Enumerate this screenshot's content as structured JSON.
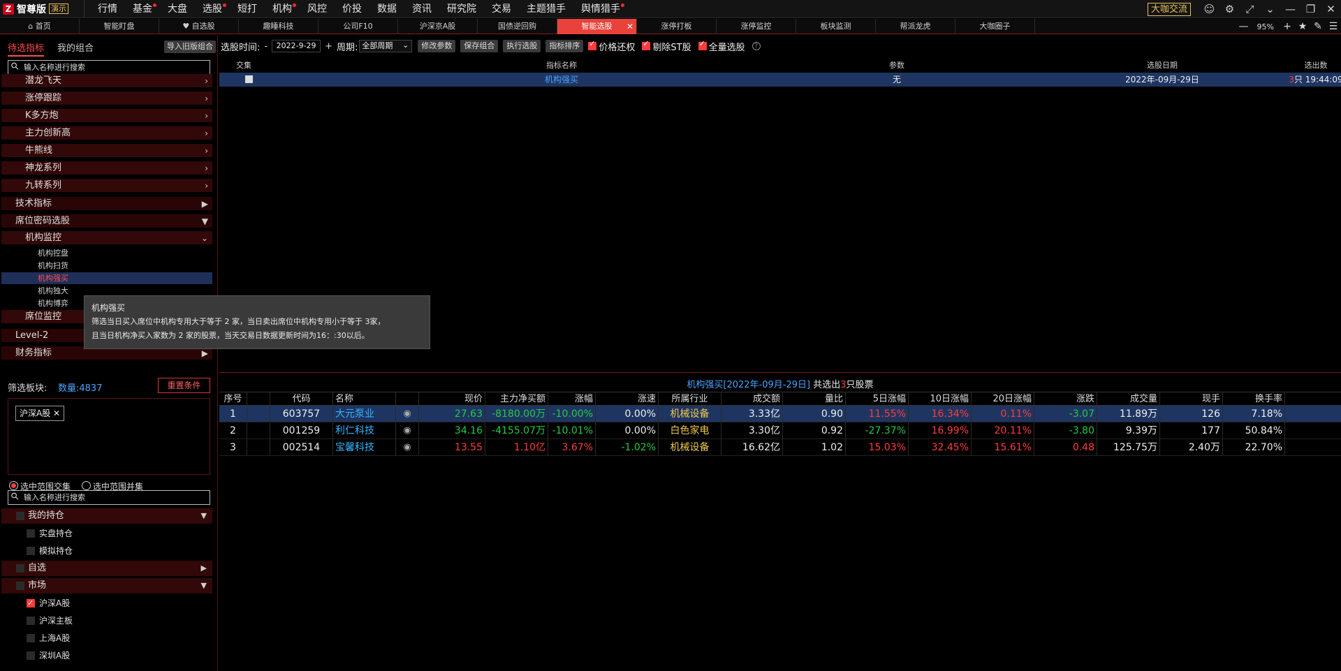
{
  "app": {
    "logo_mark": "Z",
    "brand": "智尊版",
    "demo": "演示",
    "menu": [
      {
        "label": "行情",
        "dot": false
      },
      {
        "label": "基金",
        "dot": true
      },
      {
        "label": "大盘",
        "dot": false
      },
      {
        "label": "选股",
        "dot": true
      },
      {
        "label": "短打",
        "dot": false
      },
      {
        "label": "机构",
        "dot": true
      },
      {
        "label": "风控",
        "dot": false
      },
      {
        "label": "价投",
        "dot": false
      },
      {
        "label": "数据",
        "dot": false
      },
      {
        "label": "资讯",
        "dot": false
      },
      {
        "label": "研究院",
        "dot": false
      },
      {
        "label": "交易",
        "dot": false
      },
      {
        "label": "主题猎手",
        "dot": false
      },
      {
        "label": "舆情猎手",
        "dot": true
      }
    ],
    "dkjl": "大咖交流"
  },
  "tabs": [
    "首页",
    "智能盯盘",
    "自选股",
    "趣睡科技",
    "公司F10",
    "沪深京A股",
    "国债逆回购",
    "智能选股",
    "涨停打板",
    "涨停监控",
    "板块监测",
    "帮派龙虎",
    "大咖圈子"
  ],
  "tab_icons": {
    "home": "home-icon",
    "fav": "heart-icon"
  },
  "zoom": "95%",
  "left": {
    "tab1": "待选指标",
    "tab2": "我的组合",
    "import_btn": "导入旧版组合",
    "search_placeholder": "输入名称进行搜索",
    "tree_sub": [
      "潜龙飞天",
      "涨停跟踪",
      "K多方炮",
      "主力创新高",
      "牛熊线",
      "神龙系列",
      "九转系列"
    ],
    "tree_top1": "技术指标",
    "tree_top2": "席位密码选股",
    "tree_sub2": "机构监控",
    "tree_leaves": [
      "机构控盘",
      "机构扫货",
      "机构强买",
      "机构独大",
      "机构博弈"
    ],
    "tree_sub3": "席位监控",
    "tree_top3": "Level-2",
    "tree_top4": "财务指标",
    "filter_label": "筛选板块:",
    "filter_count": "数量:4837",
    "reset_btn": "重置条件",
    "chip": "沪深A股",
    "radio1": "选中范围交集",
    "radio2": "选中范围并集",
    "search2_placeholder": "输入名称进行搜索",
    "groups": [
      {
        "label": "我的持仓",
        "kind": "grp",
        "arrow": "▼",
        "checked": false
      },
      {
        "label": "实盘持仓",
        "kind": "item",
        "checked": false
      },
      {
        "label": "模拟持仓",
        "kind": "item",
        "checked": false
      },
      {
        "label": "自选",
        "kind": "grp",
        "arrow": "▶",
        "checked": false
      },
      {
        "label": "市场",
        "kind": "grp",
        "arrow": "▼",
        "checked": false
      },
      {
        "label": "沪深A股",
        "kind": "item",
        "checked": true
      },
      {
        "label": "沪深主板",
        "kind": "item",
        "checked": false
      },
      {
        "label": "上海A股",
        "kind": "item",
        "checked": false
      },
      {
        "label": "深圳A股",
        "kind": "item",
        "checked": false
      }
    ]
  },
  "tooltip": {
    "title": "机构强买",
    "line1": "筛选当日买入席位中机构专用大于等于 2 家，当日卖出席位中机构专用小于等于 3家，",
    "line2": "且当日机构净买入家数为 2 家的股票，当天交易日数据更新时间为16：:30以后。"
  },
  "toolbar": {
    "date_label": "选股时间:",
    "minus": "-",
    "date": "2022-9-29",
    "plus": "+",
    "period_label": "周期:",
    "period": "全部周期",
    "btn_modify": "修改参数",
    "btn_save": "保存组合",
    "btn_run": "执行选股",
    "btn_sort": "指标排序",
    "chk1": "价格还权",
    "chk2": "剔除ST股",
    "chk3": "全量选股",
    "help": "?"
  },
  "upper": {
    "headers": [
      "交集",
      "指标名称",
      "参数",
      "选股日期",
      "选出数"
    ],
    "row": {
      "name": "机构强买",
      "param": "无",
      "date": "2022年-09月-29日",
      "count_num": "3",
      "count_rest": "只 19:44:09"
    }
  },
  "result": {
    "title_blue": "机构强买[2022年-09月-29日]",
    "title_mid": " 共选出",
    "title_count": "3",
    "title_end": "只股票"
  },
  "table": {
    "headers": [
      "序号",
      "",
      "代码",
      "名称",
      "",
      "现价",
      "主力净买额",
      "涨幅",
      "涨速",
      "所属行业",
      "成交额",
      "量比",
      "5日涨幅",
      "10日涨幅",
      "20日涨幅",
      "涨跌",
      "成交量",
      "现手",
      "换手率"
    ],
    "rows": [
      {
        "no": "1",
        "code": "603757",
        "name": "大元泵业",
        "price": "27.63",
        "net": "-8180.00万",
        "chg": "-10.00%",
        "speed": "0.00%",
        "ind": "机械设备",
        "amt": "3.33亿",
        "vr": "0.90",
        "d5": "11.55%",
        "d10": "16.34%",
        "d20": "0.11%",
        "diff": "-3.07",
        "vol": "11.89万",
        "hand": "126",
        "turn": "7.18%",
        "cls": {
          "price": "down",
          "net": "down",
          "chg": "down",
          "speed": "white",
          "d5": "up",
          "d10": "up",
          "d20": "up",
          "diff": "down"
        }
      },
      {
        "no": "2",
        "code": "001259",
        "name": "利仁科技",
        "price": "34.16",
        "net": "-4155.07万",
        "chg": "-10.01%",
        "speed": "0.00%",
        "ind": "白色家电",
        "amt": "3.30亿",
        "vr": "0.92",
        "d5": "-27.37%",
        "d10": "16.99%",
        "d20": "20.11%",
        "diff": "-3.80",
        "vol": "9.39万",
        "hand": "177",
        "turn": "50.84%",
        "cls": {
          "price": "down",
          "net": "down",
          "chg": "down",
          "speed": "white",
          "d5": "down",
          "d10": "up",
          "d20": "up",
          "diff": "down"
        }
      },
      {
        "no": "3",
        "code": "002514",
        "name": "宝馨科技",
        "price": "13.55",
        "net": "1.10亿",
        "chg": "3.67%",
        "speed": "-1.02%",
        "ind": "机械设备",
        "amt": "16.62亿",
        "vr": "1.02",
        "d5": "15.03%",
        "d10": "32.45%",
        "d20": "15.61%",
        "diff": "0.48",
        "vol": "125.75万",
        "hand": "2.40万",
        "turn": "22.70%",
        "cls": {
          "price": "up",
          "net": "up",
          "chg": "up",
          "speed": "down",
          "d5": "up",
          "d10": "up",
          "d20": "up",
          "diff": "up"
        }
      }
    ]
  },
  "colors": {
    "up": "#ff3b3b",
    "down": "#22cc44",
    "accent": "#e8423a",
    "select": "#1f3561"
  }
}
